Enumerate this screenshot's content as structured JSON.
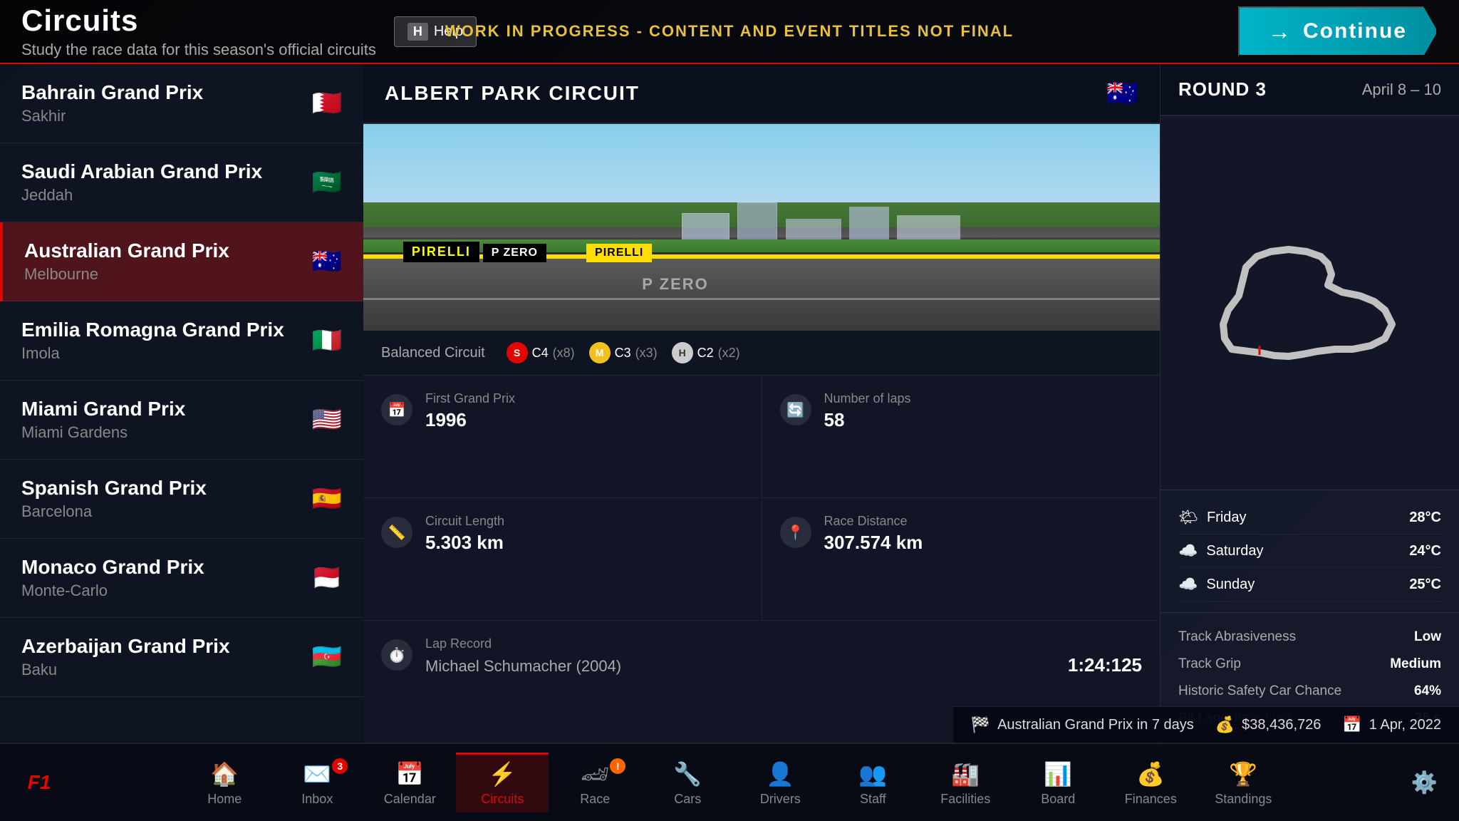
{
  "header": {
    "title": "Circuits",
    "subtitle": "Study the race data for this season's official circuits",
    "help_label": "Help",
    "help_key": "H",
    "wip_notice": "WORK IN PROGRESS - CONTENT AND EVENT TITLES NOT FINAL",
    "continue_label": "Continue"
  },
  "circuits": [
    {
      "name": "Bahrain Grand Prix",
      "location": "Sakhir",
      "flag": "🇧🇭",
      "active": false
    },
    {
      "name": "Saudi Arabian Grand Prix",
      "location": "Jeddah",
      "flag": "🇸🇦",
      "active": false
    },
    {
      "name": "Australian Grand Prix",
      "location": "Melbourne",
      "flag": "🇦🇺",
      "active": true
    },
    {
      "name": "Emilia Romagna Grand Prix",
      "location": "Imola",
      "flag": "🇮🇹",
      "active": false
    },
    {
      "name": "Miami Grand Prix",
      "location": "Miami Gardens",
      "flag": "🇺🇸",
      "active": false
    },
    {
      "name": "Spanish Grand Prix",
      "location": "Barcelona",
      "flag": "🇪🇸",
      "active": false
    },
    {
      "name": "Monaco Grand Prix",
      "location": "Monte-Carlo",
      "flag": "🇲🇨",
      "active": false
    },
    {
      "name": "Azerbaijan Grand Prix",
      "location": "Baku",
      "flag": "🇦🇿",
      "active": false
    }
  ],
  "circuit_detail": {
    "name": "ALBERT PARK CIRCUIT",
    "flag": "🇦🇺",
    "type": "Balanced Circuit",
    "tyres": {
      "soft_label": "C4",
      "soft_count": "x8",
      "medium_label": "C3",
      "medium_count": "x3",
      "hard_label": "C2",
      "hard_count": "x2"
    },
    "first_gp_label": "First Grand Prix",
    "first_gp_value": "1996",
    "laps_label": "Number of laps",
    "laps_value": "58",
    "length_label": "Circuit Length",
    "length_value": "5.303 km",
    "distance_label": "Race Distance",
    "distance_value": "307.574 km",
    "lap_record_label": "Lap Record",
    "lap_record_holder": "Michael Schumacher (2004)",
    "lap_record_time": "1:24:125"
  },
  "round": {
    "label": "ROUND 3",
    "date": "April 8 – 10",
    "weather": [
      {
        "day": "Friday",
        "icon": "🌤",
        "temp": "28°C"
      },
      {
        "day": "Saturday",
        "icon": "☁️",
        "temp": "24°C"
      },
      {
        "day": "Sunday",
        "icon": "☁️",
        "temp": "25°C"
      }
    ],
    "conditions": [
      {
        "label": "Track Abrasiveness",
        "value": "Low"
      },
      {
        "label": "Track Grip",
        "value": "Medium"
      },
      {
        "label": "Historic Safety Car Chance",
        "value": "64%"
      },
      {
        "label": "Pit Lane Time Loss",
        "value": "25 s"
      }
    ]
  },
  "status_bar": {
    "race_label": "Australian Grand Prix in 7 days",
    "money": "$38,436,726",
    "date": "1 Apr, 2022"
  },
  "nav": {
    "items": [
      {
        "id": "home",
        "label": "Home",
        "icon": "🏠",
        "badge": null,
        "active": false
      },
      {
        "id": "inbox",
        "label": "Inbox",
        "icon": "✉️",
        "badge": "3",
        "active": false
      },
      {
        "id": "calendar",
        "label": "Calendar",
        "icon": "📅",
        "badge": null,
        "active": false
      },
      {
        "id": "circuits",
        "label": "Circuits",
        "icon": "⚡",
        "badge": null,
        "active": true
      },
      {
        "id": "race",
        "label": "Race",
        "icon": "🏎",
        "badge": "!",
        "active": false
      },
      {
        "id": "cars",
        "label": "Cars",
        "icon": "🔧",
        "badge": null,
        "active": false
      },
      {
        "id": "drivers",
        "label": "Drivers",
        "icon": "👤",
        "badge": null,
        "active": false
      },
      {
        "id": "staff",
        "label": "Staff",
        "icon": "👥",
        "badge": null,
        "active": false
      },
      {
        "id": "facilities",
        "label": "Facilities",
        "icon": "🏭",
        "badge": null,
        "active": false
      },
      {
        "id": "board",
        "label": "Board",
        "icon": "📊",
        "badge": null,
        "active": false
      },
      {
        "id": "finances",
        "label": "Finances",
        "icon": "💰",
        "badge": null,
        "active": false
      },
      {
        "id": "standings",
        "label": "Standings",
        "icon": "🏆",
        "badge": null,
        "active": false
      }
    ]
  }
}
